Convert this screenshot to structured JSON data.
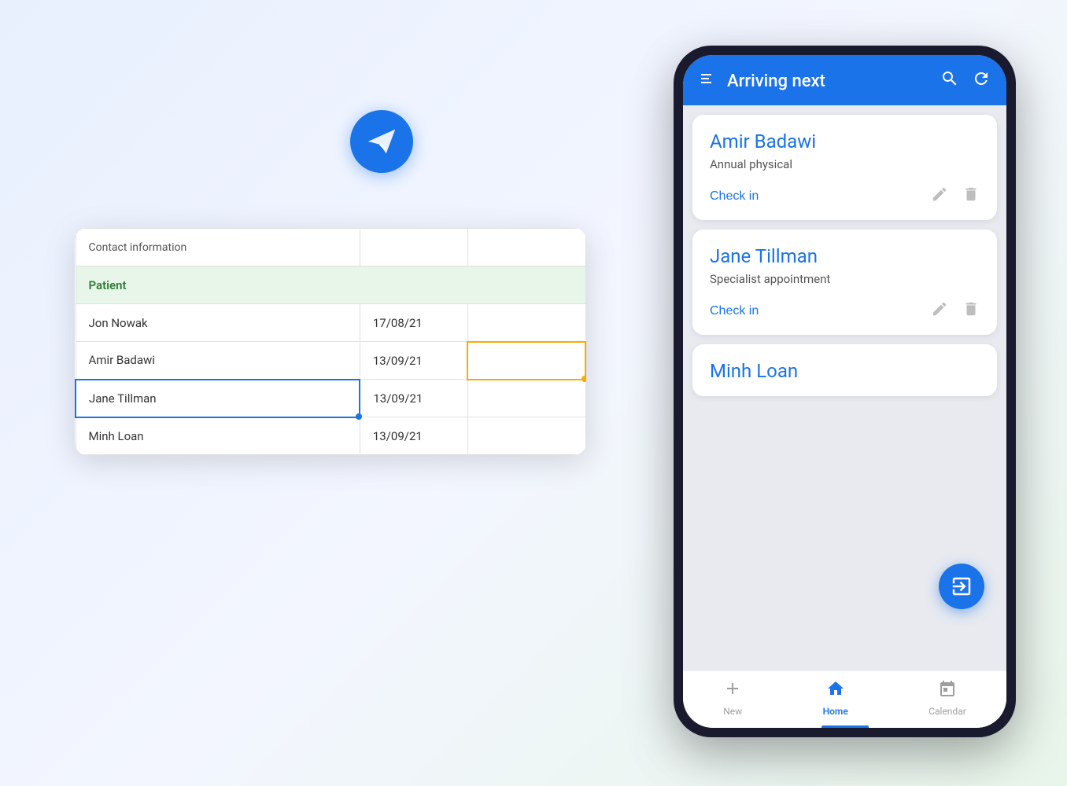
{
  "scene": {
    "background": "#e8f0fe"
  },
  "spreadsheet": {
    "header": "Contact information",
    "section_label": "Patient",
    "rows": [
      {
        "name": "Jon Nowak",
        "date": "17/08/21",
        "extra": ""
      },
      {
        "name": "Amir Badawi",
        "date": "13/09/21",
        "extra": "",
        "active_cell": true
      },
      {
        "name": "Jane Tillman",
        "date": "13/09/21",
        "extra": "",
        "selected": true
      },
      {
        "name": "Minh Loan",
        "date": "13/09/21",
        "extra": ""
      }
    ]
  },
  "phone": {
    "header": {
      "title": "Arriving next",
      "search_icon": "search",
      "refresh_icon": "refresh",
      "menu_icon": "menu"
    },
    "patients": [
      {
        "name": "Amir Badawi",
        "appointment": "Annual physical",
        "checkin_label": "Check in"
      },
      {
        "name": "Jane Tillman",
        "appointment": "Specialist appointment",
        "checkin_label": "Check in"
      },
      {
        "name": "Minh Loan",
        "appointment": "",
        "checkin_label": ""
      }
    ],
    "nav": [
      {
        "label": "New",
        "icon": "add",
        "active": false
      },
      {
        "label": "Home",
        "icon": "home",
        "active": true
      },
      {
        "label": "Calendar",
        "icon": "calendar",
        "active": false
      }
    ]
  }
}
